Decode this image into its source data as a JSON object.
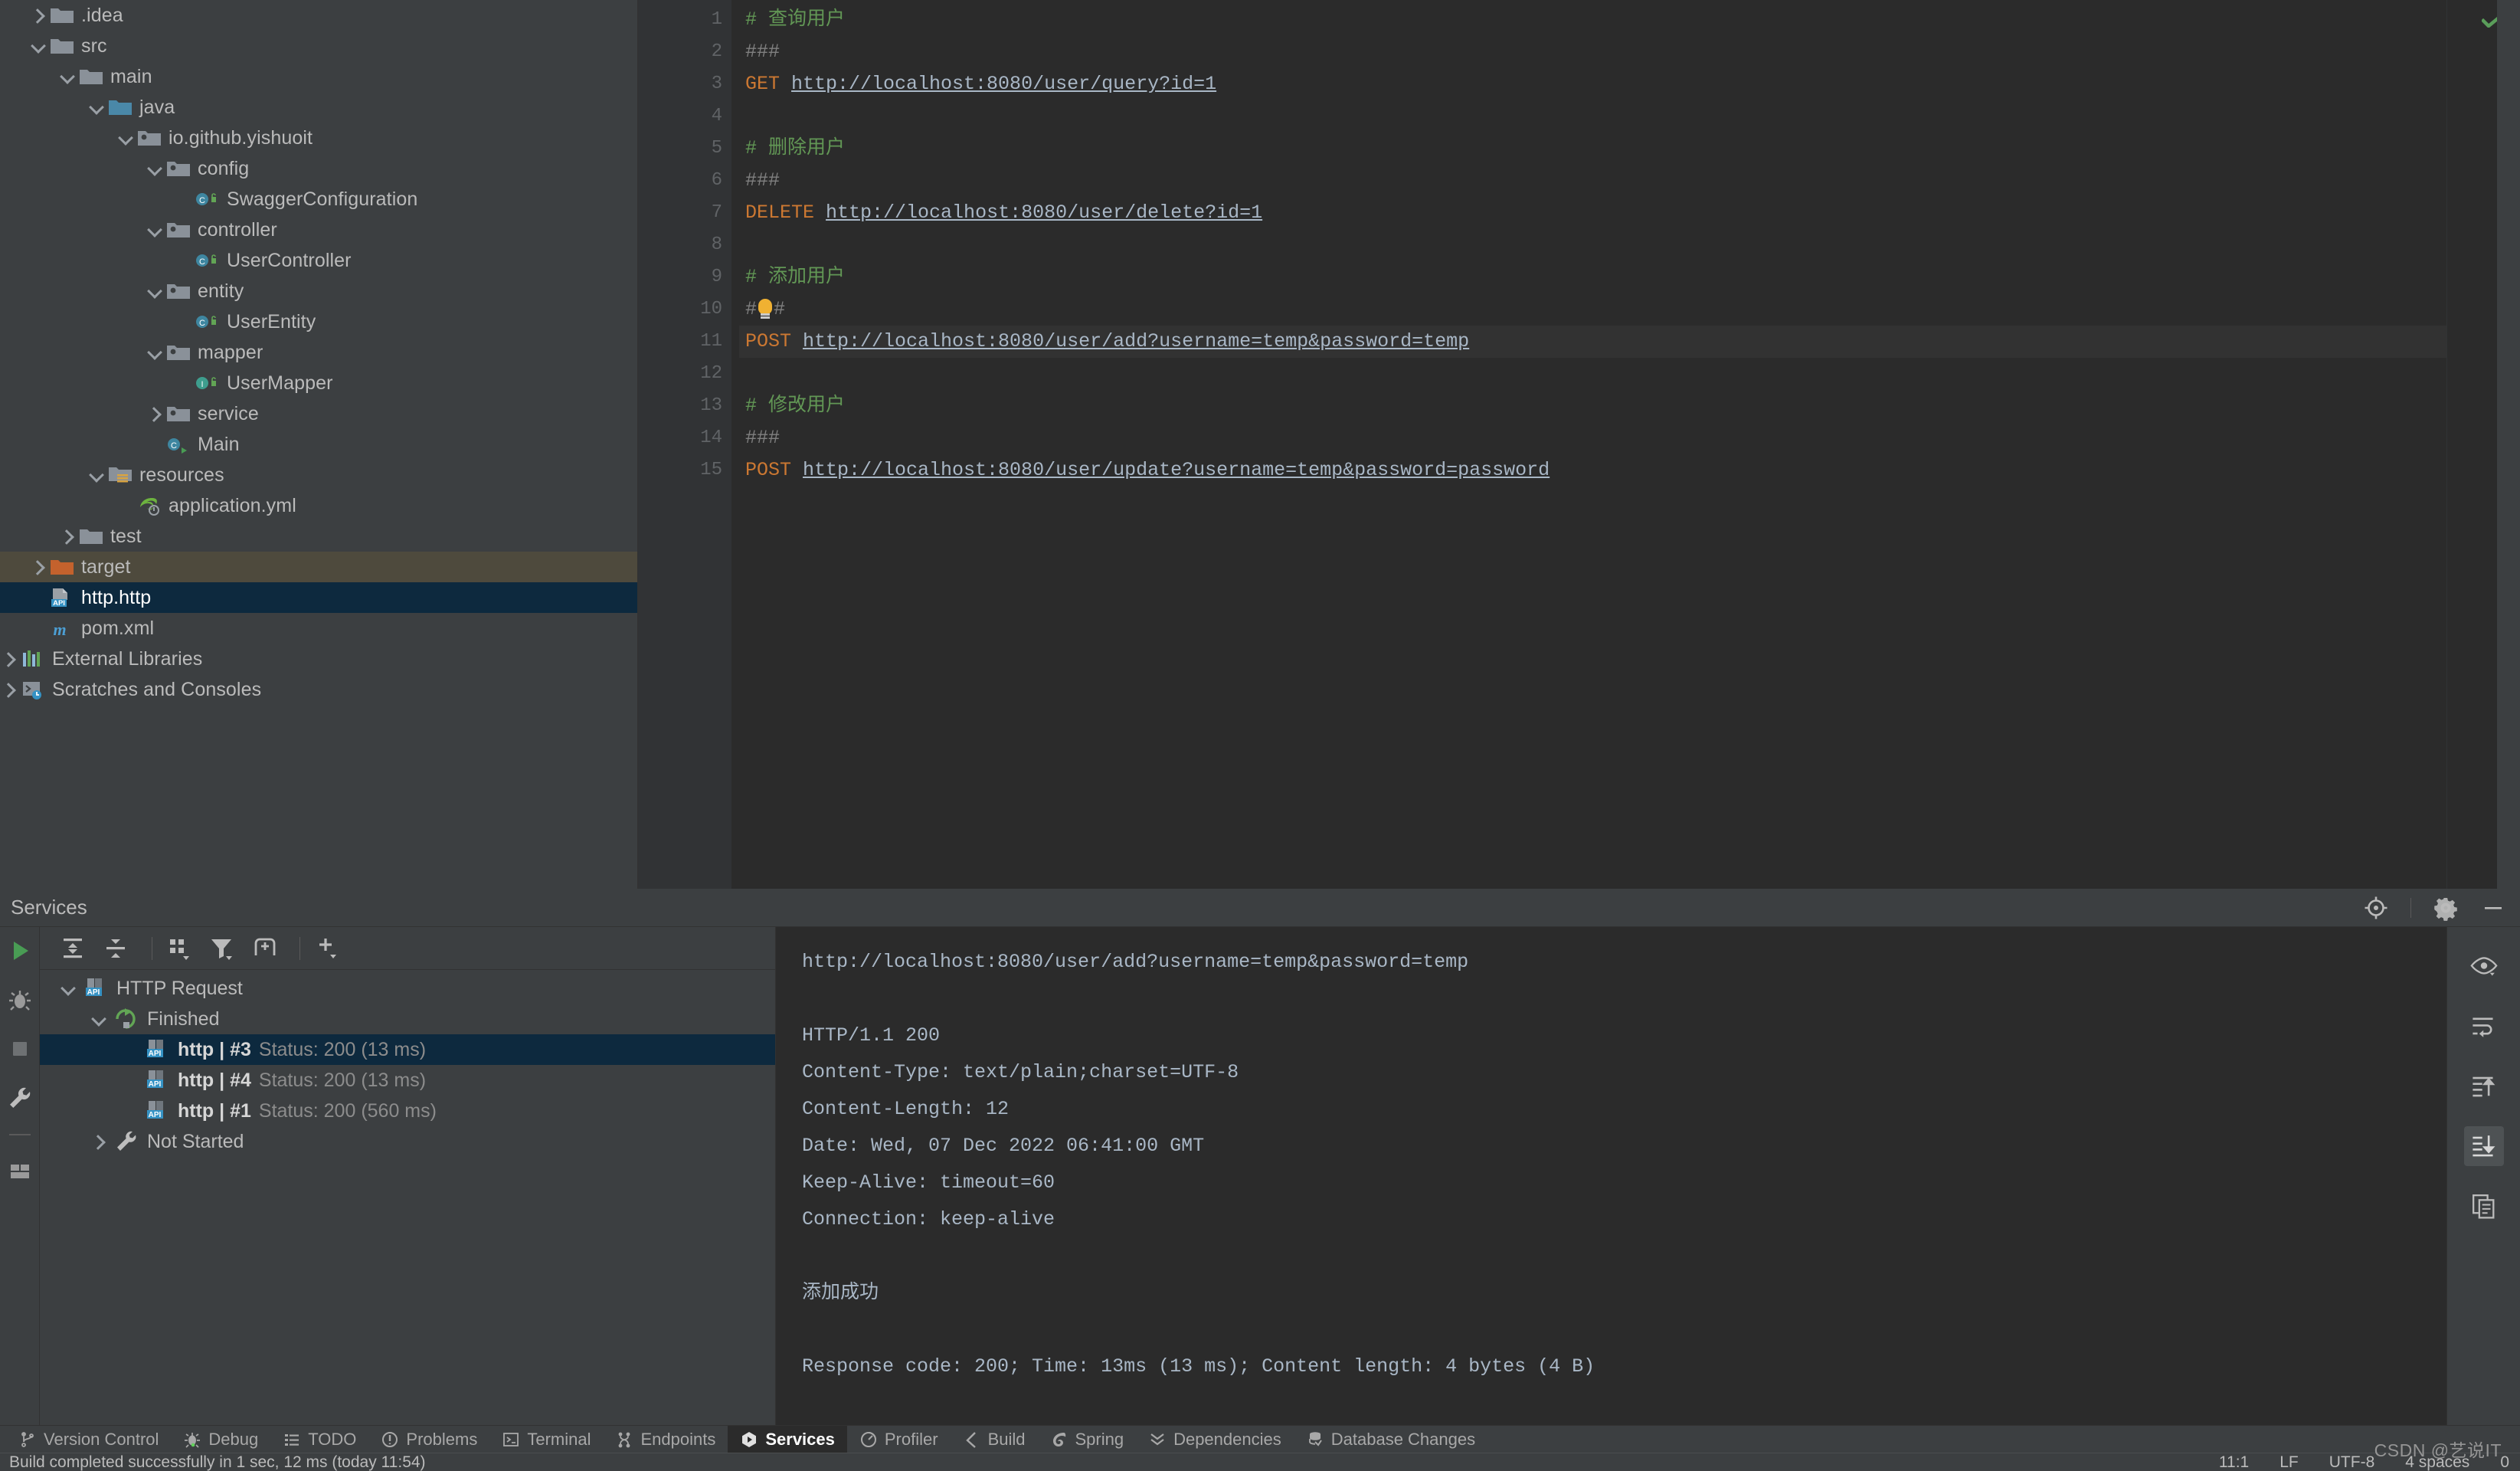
{
  "project_tree": {
    "items": [
      {
        "label": ".idea",
        "depth": 0,
        "chev": "closed",
        "icon": "folder-icon",
        "state": "normal"
      },
      {
        "label": "src",
        "depth": 0,
        "chev": "open",
        "icon": "folder-icon",
        "state": "normal"
      },
      {
        "label": "main",
        "depth": 1,
        "chev": "open",
        "icon": "folder-icon",
        "state": "normal"
      },
      {
        "label": "java",
        "depth": 2,
        "chev": "open",
        "icon": "source-root-folder-icon",
        "state": "normal"
      },
      {
        "label": "io.github.yishuoit",
        "depth": 3,
        "chev": "open",
        "icon": "package-icon",
        "state": "normal"
      },
      {
        "label": "config",
        "depth": 4,
        "chev": "open",
        "icon": "package-icon",
        "state": "normal"
      },
      {
        "label": "SwaggerConfiguration",
        "depth": 5,
        "chev": "none",
        "icon": "java-class-icon",
        "state": "normal"
      },
      {
        "label": "controller",
        "depth": 4,
        "chev": "open",
        "icon": "package-icon",
        "state": "normal"
      },
      {
        "label": "UserController",
        "depth": 5,
        "chev": "none",
        "icon": "java-class-icon",
        "state": "normal"
      },
      {
        "label": "entity",
        "depth": 4,
        "chev": "open",
        "icon": "package-icon",
        "state": "normal"
      },
      {
        "label": "UserEntity",
        "depth": 5,
        "chev": "none",
        "icon": "java-class-icon",
        "state": "normal"
      },
      {
        "label": "mapper",
        "depth": 4,
        "chev": "open",
        "icon": "package-icon",
        "state": "normal"
      },
      {
        "label": "UserMapper",
        "depth": 5,
        "chev": "none",
        "icon": "java-interface-icon",
        "state": "normal"
      },
      {
        "label": "service",
        "depth": 4,
        "chev": "closed",
        "icon": "package-icon",
        "state": "normal"
      },
      {
        "label": "Main",
        "depth": 4,
        "chev": "none",
        "icon": "java-class-run-icon",
        "state": "normal"
      },
      {
        "label": "resources",
        "depth": 2,
        "chev": "open",
        "icon": "resources-folder-icon",
        "state": "normal"
      },
      {
        "label": "application.yml",
        "depth": 3,
        "chev": "none",
        "icon": "spring-yml-icon",
        "state": "normal"
      },
      {
        "label": "test",
        "depth": 1,
        "chev": "closed",
        "icon": "folder-icon",
        "state": "normal"
      },
      {
        "label": "target",
        "depth": 0,
        "chev": "closed",
        "icon": "excluded-folder-icon",
        "state": "excluded"
      },
      {
        "label": "http.http",
        "depth": 0,
        "chev": "none",
        "icon": "http-file-icon",
        "state": "selected"
      },
      {
        "label": "pom.xml",
        "depth": 0,
        "chev": "none",
        "icon": "maven-icon",
        "state": "normal"
      },
      {
        "label": "External Libraries",
        "depth": -1,
        "chev": "closed",
        "icon": "libraries-icon",
        "state": "normal"
      },
      {
        "label": "Scratches and Consoles",
        "depth": -1,
        "chev": "closed",
        "icon": "scratches-icon",
        "state": "normal"
      }
    ]
  },
  "editor": {
    "lines": [
      {
        "n": "1",
        "run": false,
        "hl": false,
        "tokens": [
          {
            "t": "# 查询用户",
            "c": "c-comment"
          }
        ]
      },
      {
        "n": "2",
        "run": false,
        "hl": false,
        "tokens": [
          {
            "t": "###",
            "c": "c-sep"
          }
        ]
      },
      {
        "n": "3",
        "run": true,
        "hl": false,
        "tokens": [
          {
            "t": "GET ",
            "c": "c-method"
          },
          {
            "t": "http://localhost:8080/user/query?id=1",
            "c": "c-url"
          }
        ]
      },
      {
        "n": "4",
        "run": false,
        "hl": false,
        "tokens": [
          {
            "t": " ",
            "c": "c-sep"
          }
        ]
      },
      {
        "n": "5",
        "run": false,
        "hl": false,
        "tokens": [
          {
            "t": "# 删除用户",
            "c": "c-comment"
          }
        ]
      },
      {
        "n": "6",
        "run": false,
        "hl": false,
        "tokens": [
          {
            "t": "###",
            "c": "c-sep"
          }
        ]
      },
      {
        "n": "7",
        "run": true,
        "hl": false,
        "tokens": [
          {
            "t": "DELETE ",
            "c": "c-method"
          },
          {
            "t": "http://localhost:8080/user/delete?id=1",
            "c": "c-url"
          }
        ]
      },
      {
        "n": "8",
        "run": false,
        "hl": false,
        "tokens": [
          {
            "t": " ",
            "c": "c-sep"
          }
        ]
      },
      {
        "n": "9",
        "run": false,
        "hl": false,
        "tokens": [
          {
            "t": "# 添加用户",
            "c": "c-comment"
          }
        ]
      },
      {
        "n": "10",
        "run": false,
        "hl": false,
        "bulb": true,
        "tokens": [
          {
            "t": "#",
            "c": "c-sep"
          },
          {
            "t": "#",
            "c": "c-sep"
          }
        ]
      },
      {
        "n": "11",
        "run": true,
        "hl": true,
        "tokens": [
          {
            "t": "POST ",
            "c": "c-method"
          },
          {
            "t": "http://localhost:8080/user/add?username=temp&password=temp",
            "c": "c-url"
          }
        ]
      },
      {
        "n": "12",
        "run": false,
        "hl": false,
        "tokens": [
          {
            "t": " ",
            "c": "c-sep"
          }
        ]
      },
      {
        "n": "13",
        "run": false,
        "hl": false,
        "tokens": [
          {
            "t": "# 修改用户",
            "c": "c-comment"
          }
        ]
      },
      {
        "n": "14",
        "run": false,
        "hl": false,
        "tokens": [
          {
            "t": "###",
            "c": "c-sep"
          }
        ]
      },
      {
        "n": "15",
        "run": true,
        "hl": false,
        "tokens": [
          {
            "t": "POST ",
            "c": "c-method"
          },
          {
            "t": "http://localhost:8080/user/update?username=temp&password=password",
            "c": "c-url"
          }
        ]
      }
    ],
    "inspection_status": "ok-checkmark"
  },
  "services": {
    "title": "Services",
    "header_actions": [
      "locate-icon",
      "gear-icon",
      "minimize-icon"
    ],
    "sidebar_icons": [
      "run-icon",
      "debug-icon",
      "stop-icon",
      "wrench-icon",
      "layout-icon"
    ],
    "toolbar_buttons": [
      "expand-all-icon",
      "collapse-all-icon",
      "group-by-icon",
      "filter-icon",
      "add-tab-icon",
      "add-service-icon"
    ],
    "tree": [
      {
        "label": "HTTP Request",
        "depth": 0,
        "chev": "open",
        "icon": "http-request-icon",
        "selected": false
      },
      {
        "label": "Finished",
        "depth": 1,
        "chev": "open",
        "icon": "finished-icon",
        "selected": false
      },
      {
        "name": "http  |  #3",
        "status": "Status: 200 (13 ms)",
        "depth": 2,
        "chev": "none",
        "icon": "http-request-icon",
        "selected": true
      },
      {
        "name": "http  |  #4",
        "status": "Status: 200 (13 ms)",
        "depth": 2,
        "chev": "none",
        "icon": "http-request-icon",
        "selected": false
      },
      {
        "name": "http  |  #1",
        "status": "Status: 200 (560 ms)",
        "depth": 2,
        "chev": "none",
        "icon": "http-request-icon",
        "selected": false
      },
      {
        "label": "Not Started",
        "depth": 1,
        "chev": "closed",
        "icon": "wrench-icon",
        "selected": false
      }
    ],
    "response": {
      "lines": [
        "http://localhost:8080/user/add?username=temp&password=temp",
        "",
        "HTTP/1.1 200",
        "Content-Type: text/plain;charset=UTF-8",
        "Content-Length: 12",
        "Date: Wed, 07 Dec 2022 06:41:00 GMT",
        "Keep-Alive: timeout=60",
        "Connection: keep-alive",
        "",
        "添加成功",
        "",
        "Response code: 200; Time: 13ms (13 ms); Content length: 4 bytes (4 B)"
      ]
    },
    "response_rail_icons": [
      "eye-icon",
      "soft-wrap-icon",
      "scroll-up-icon",
      "scroll-to-end-icon",
      "copy-icon"
    ]
  },
  "tool_window_tabs": [
    {
      "label": "Version Control",
      "icon": "branch-icon",
      "active": false
    },
    {
      "label": "Debug",
      "icon": "debug-icon",
      "active": false
    },
    {
      "label": "TODO",
      "icon": "todo-icon",
      "active": false
    },
    {
      "label": "Problems",
      "icon": "problems-icon",
      "active": false
    },
    {
      "label": "Terminal",
      "icon": "terminal-icon",
      "active": false
    },
    {
      "label": "Endpoints",
      "icon": "endpoints-icon",
      "active": false
    },
    {
      "label": "Services",
      "icon": "services-icon",
      "active": true
    },
    {
      "label": "Profiler",
      "icon": "profiler-icon",
      "active": false
    },
    {
      "label": "Build",
      "icon": "build-icon",
      "active": false
    },
    {
      "label": "Spring",
      "icon": "spring-icon",
      "active": false
    },
    {
      "label": "Dependencies",
      "icon": "dependencies-icon",
      "active": false
    },
    {
      "label": "Database Changes",
      "icon": "database-changes-icon",
      "active": false
    }
  ],
  "status_bar": {
    "message": "Build completed successfully in 1 sec, 12 ms (today 11:54)",
    "caret": "11:1",
    "line_sep": "LF",
    "encoding": "UTF-8",
    "indent": "4 spaces",
    "branch": "0"
  },
  "watermark": "CSDN @艺说IT",
  "colors": {
    "panel_bg": "#3c3f41",
    "editor_bg": "#2b2b2b",
    "gutter_bg": "#313335",
    "selection": "#0d293e",
    "excluded_row": "#4e4a3d",
    "comment_green": "#629755",
    "method_orange": "#cc7832",
    "url_grey": "#a9b7c6",
    "run_green": "#499c54",
    "text": "#bbbbbb"
  }
}
